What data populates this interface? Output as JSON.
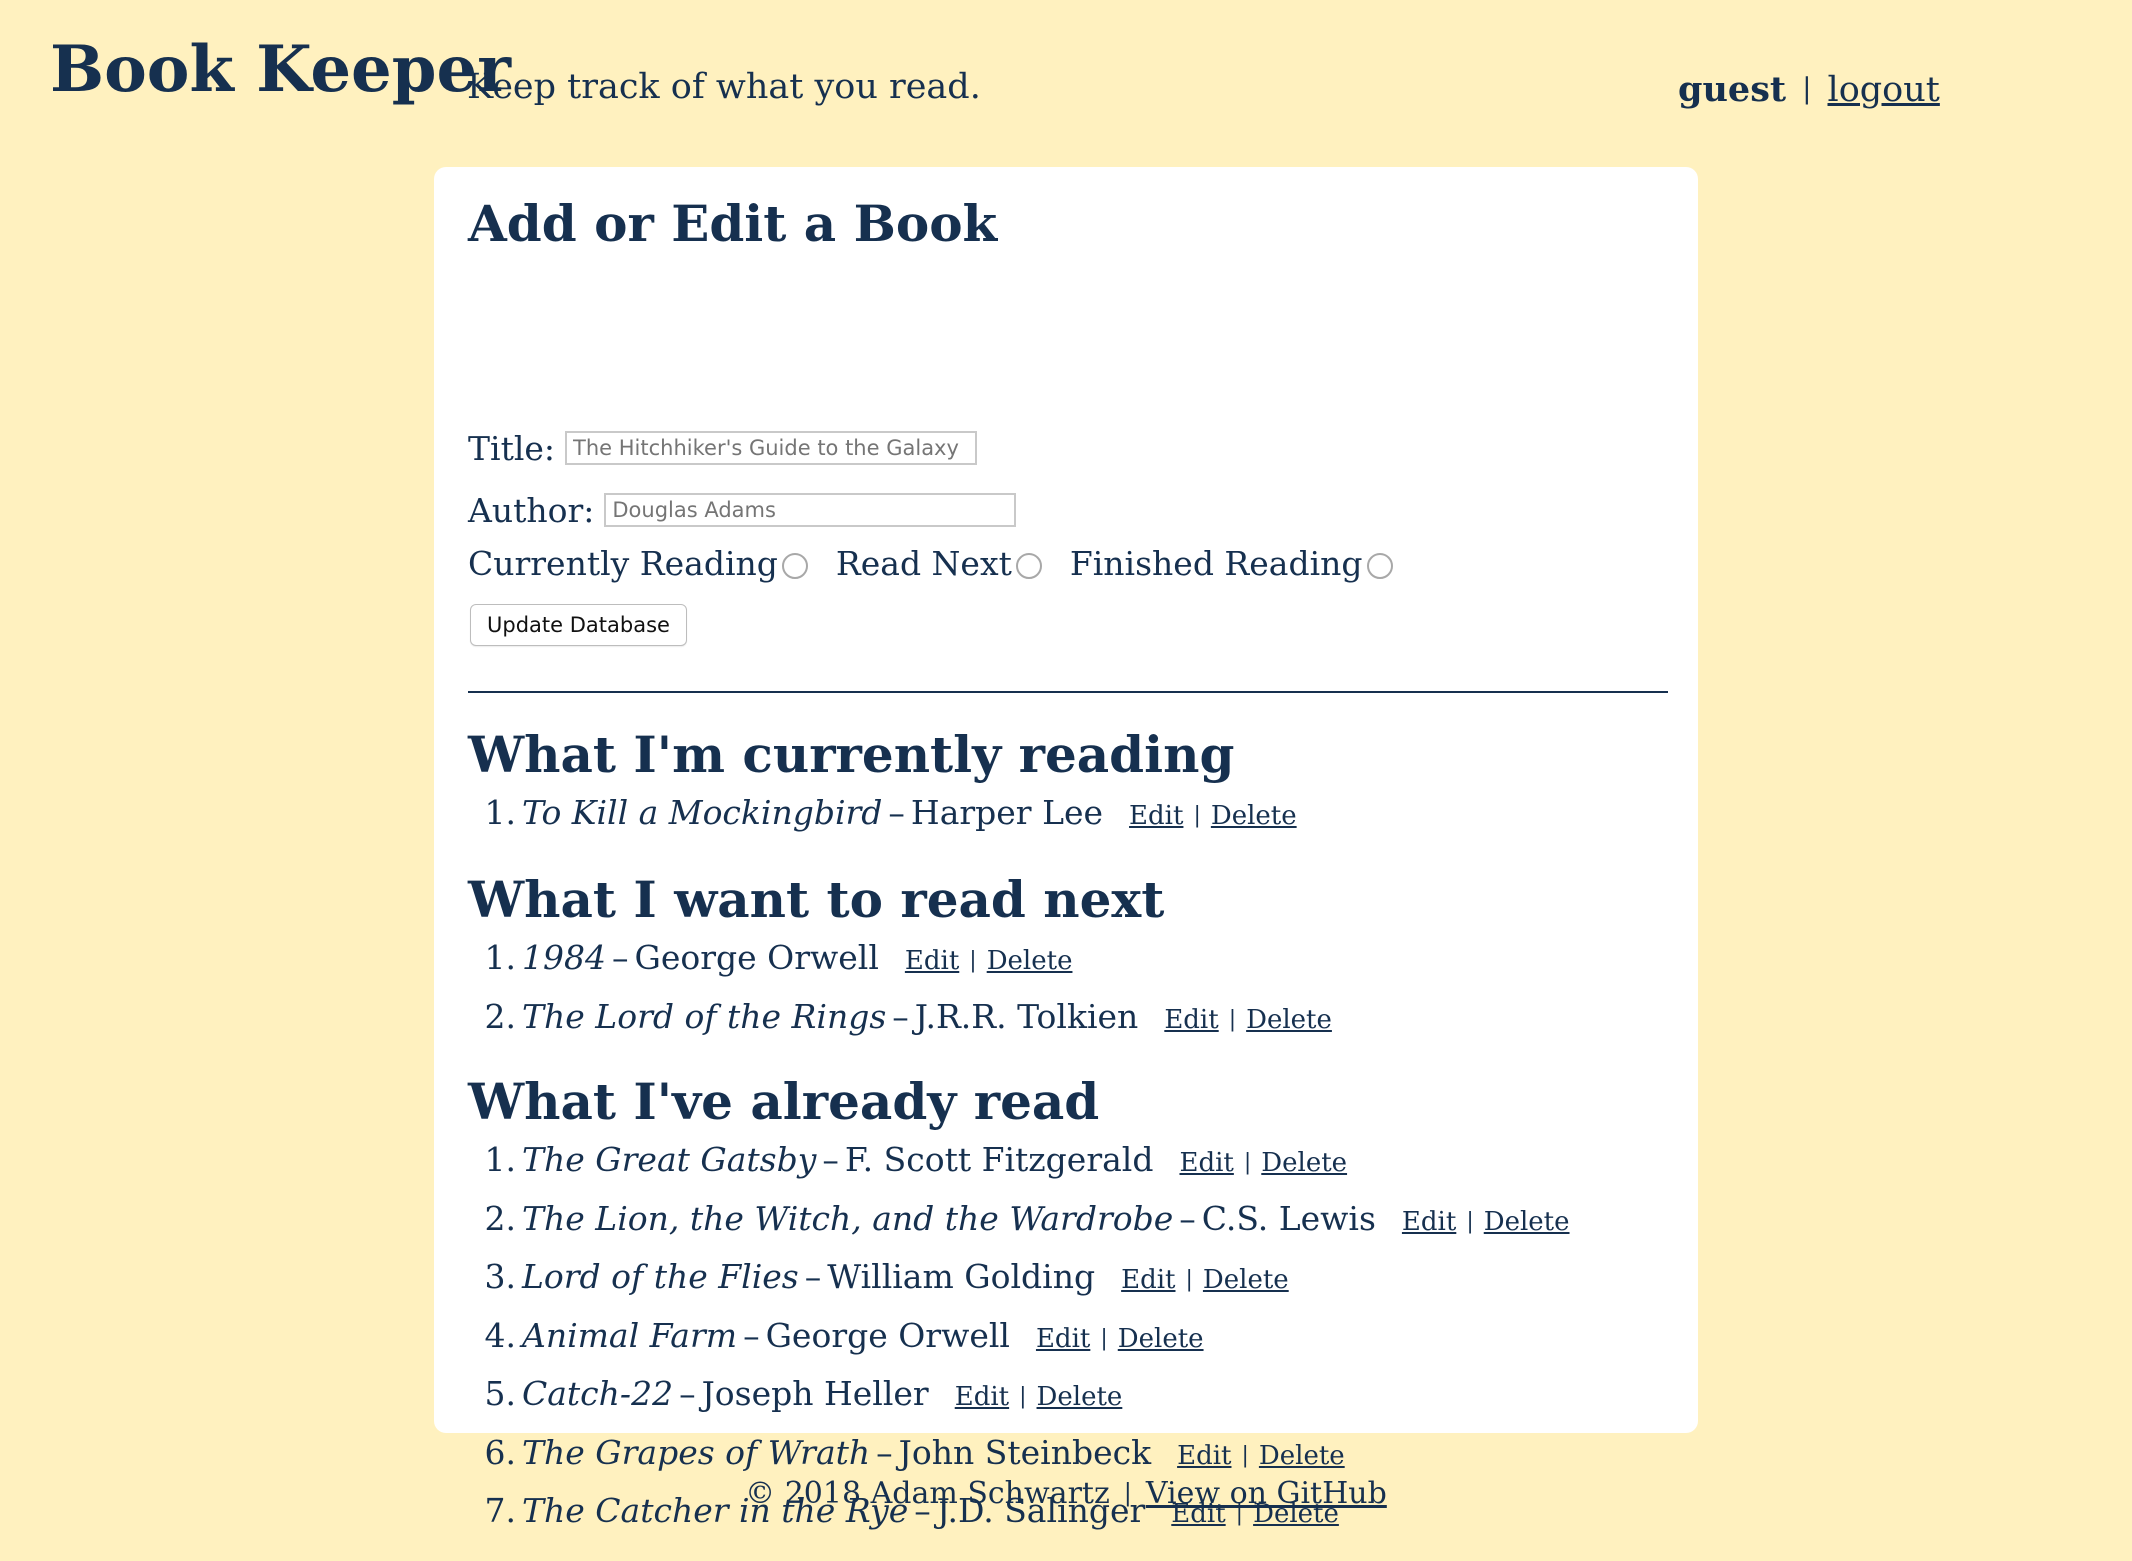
{
  "header": {
    "app_title": "Book Keeper",
    "tagline": "Keep track of what you read.",
    "username": "guest",
    "separator": "|",
    "logout_label": "logout"
  },
  "form": {
    "heading": "Add or Edit a Book",
    "title_label": "Title:",
    "title_placeholder": "The Hitchhiker's Guide to the Galaxy",
    "author_label": "Author:",
    "author_placeholder": "Douglas Adams",
    "radio_currently": "Currently Reading",
    "radio_next": "Read Next",
    "radio_finished": "Finished Reading",
    "submit_label": "Update Database"
  },
  "lists": {
    "edit_label": "Edit",
    "delete_label": "Delete",
    "separator": "|",
    "dash": "–",
    "currently": {
      "heading": "What I'm currently reading",
      "books": [
        {
          "num": "1.",
          "title": "To Kill a Mockingbird",
          "author": "Harper Lee"
        }
      ]
    },
    "next": {
      "heading": "What I want to read next",
      "books": [
        {
          "num": "1.",
          "title": "1984",
          "author": "George Orwell"
        },
        {
          "num": "2.",
          "title": "The Lord of the Rings",
          "author": "J.R.R. Tolkien"
        }
      ]
    },
    "finished": {
      "heading": "What I've already read",
      "books": [
        {
          "num": "1.",
          "title": "The Great Gatsby",
          "author": "F. Scott Fitzgerald"
        },
        {
          "num": "2.",
          "title": "The Lion, the Witch, and the Wardrobe",
          "author": "C.S. Lewis"
        },
        {
          "num": "3.",
          "title": "Lord of the Flies",
          "author": "William Golding"
        },
        {
          "num": "4.",
          "title": "Animal Farm",
          "author": "George Orwell"
        },
        {
          "num": "5.",
          "title": "Catch-22",
          "author": "Joseph Heller"
        },
        {
          "num": "6.",
          "title": "The Grapes of Wrath",
          "author": "John Steinbeck"
        },
        {
          "num": "7.",
          "title": "The Catcher in the Rye",
          "author": "J.D. Salinger"
        }
      ]
    }
  },
  "footer": {
    "copyright": "© 2018 Adam Schwartz",
    "separator": "|",
    "github_label": "View on GitHub"
  },
  "colors": {
    "page_background": "#fff1bf",
    "text": "#16304f",
    "card_background": "#ffffff"
  }
}
